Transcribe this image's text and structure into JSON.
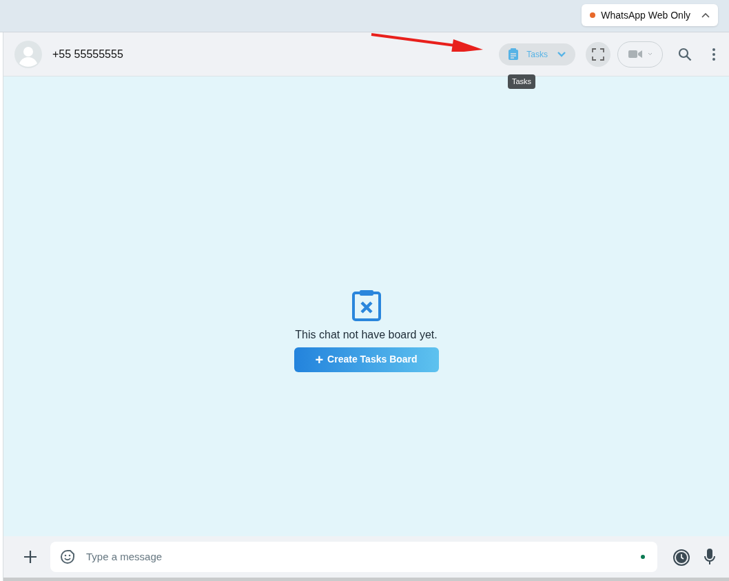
{
  "mode_badge": {
    "label": "WhatsApp Web Only",
    "color": "#e8692a"
  },
  "chat_header": {
    "contact": "+55 55555555",
    "tasks_button": {
      "label": "Tasks"
    },
    "tooltip": "Tasks"
  },
  "board": {
    "message": "This chat not have board yet.",
    "create_button": {
      "icon": "+",
      "label": "Create Tasks Board"
    }
  },
  "composer": {
    "placeholder": "Type a message"
  }
}
